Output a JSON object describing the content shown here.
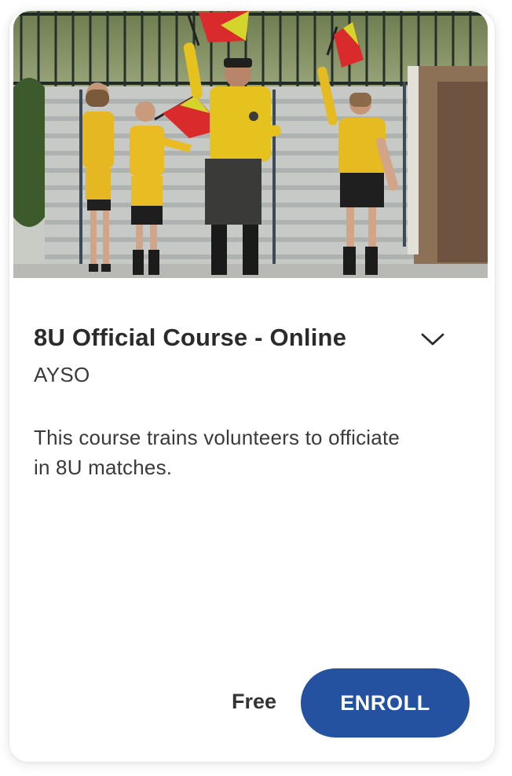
{
  "course": {
    "title": "8U Official Course - Online",
    "organization": "AYSO",
    "description": "This course trains volunteers to officiate in 8U matches.",
    "price": "Free",
    "enroll_label": "ENROLL",
    "hero_image": "photo of youth referees holding flags on stadium steps",
    "expand_icon": "chevron-down-icon"
  },
  "colors": {
    "accent": "#2451a0",
    "title_text": "#2b2b2b",
    "body_text": "#3a3a3a"
  }
}
